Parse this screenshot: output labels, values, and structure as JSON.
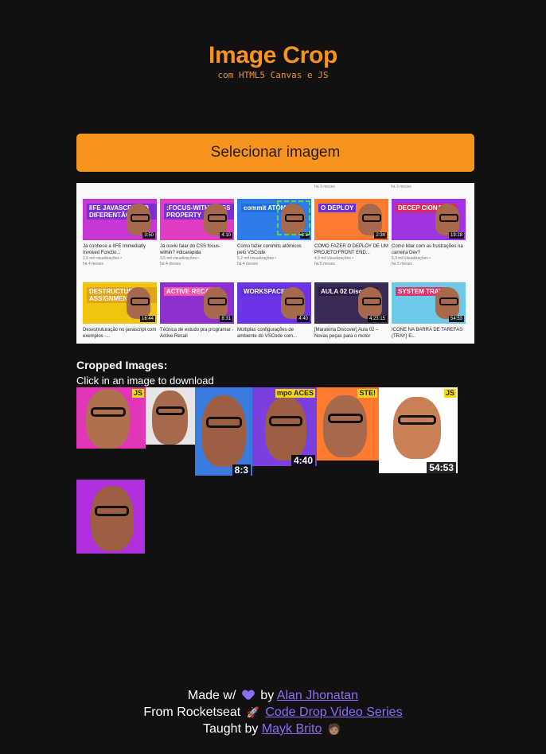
{
  "header": {
    "title": "Image Crop",
    "subtitle": "com HTML5 Canvas e JS"
  },
  "select_button": {
    "label": "Selecionar imagem"
  },
  "preview": {
    "top_meta": [
      "há 3 meses",
      "há 3 meses"
    ],
    "rows": [
      [
        {
          "tag": "IIFE JAVASCRIPT O DIFERENTÃO",
          "tag_color": "#7b2fd0",
          "bg": "#c936d6",
          "duration": "3:50",
          "title": "Já conhece a IIFE Immediatly Invoked Functio...",
          "views": "2,6 mil visualizações •",
          "age": "há 4 meses"
        },
        {
          "tag": ":FOCUS-WITHIN CSS PROPERTY",
          "tag_color": "#7b2fd0",
          "bg": "#e23cc4",
          "duration": "4:10",
          "title": "Já ouviu falar do CSS focus-within? #dicarapida",
          "views": "3,5 mil visualizações •",
          "age": "há 4 meses"
        },
        {
          "tag": "commit ATÔMICO",
          "tag_color": "#1f6fe0",
          "bg": "#2f7be9",
          "duration": "8:3",
          "title": "Como fazer commits atômicos pelo VSCode",
          "views": "5,2 mil visualizações •",
          "age": "há 4 meses"
        },
        {
          "tag": "O DEPLOY",
          "tag_color": "#6b2fd9",
          "bg": "#ff7a2e",
          "duration": "2:34",
          "title": "COMO FAZER O DEPLOY DE UM PROJETO FRONT END...",
          "views": "4,9 mil visualizações •",
          "age": "há 5 meses"
        },
        {
          "tag": "DECEP CIONADO!",
          "tag_color": "#e0265f",
          "bg": "#9f34e0",
          "duration": "19:28",
          "title": "Como lidar com as frustrações na carreira Dev?",
          "views": "6,3 mil visualizações •",
          "age": "há 5 meses"
        }
      ],
      [
        {
          "tag": "DESTRUCTURING ASSIGNMENT",
          "tag_color": "#e3a21a",
          "bg": "#f1c40f",
          "duration": "16:44",
          "title": "Desestruturação no javascript com exemplos -...",
          "views": "",
          "age": ""
        },
        {
          "tag": "ACTIVE RECALL",
          "tag_color": "#ff4fa6",
          "bg": "#8e2fd0",
          "duration": "8:31",
          "title": "Técnica de estudo pra programar - Active Recall",
          "views": "",
          "age": ""
        },
        {
          "tag": "WORKSPACES",
          "tag_color": "#5b2fd9",
          "bg": "#6b34e6",
          "duration": "4:40",
          "title": "Múltiplas configurações de ambiente do VSCode com...",
          "views": "",
          "age": ""
        },
        {
          "tag": "AULA 02 Discover",
          "tag_color": "#2b1a46",
          "bg": "#3a2a58",
          "duration": "4:23:15",
          "title": "[Maratona Discover] Aula 02 – Novas peças para o motor",
          "views": "",
          "age": ""
        },
        {
          "tag": "SYSTEM TRAY",
          "tag_color": "#e2336b",
          "bg": "#6cc9e8",
          "duration": "54:53",
          "title": "ÍCONE NA BARRA DE TAREFAS (TRAY) E...",
          "views": "",
          "age": ""
        }
      ]
    ]
  },
  "cropped": {
    "heading": "Cropped Images:",
    "hint": "Click in an image to download",
    "items": [
      {
        "bg": "#e236b8",
        "skin": "#b07050",
        "label": "",
        "badge": "JS"
      },
      {
        "bg": "#e6e6e6",
        "skin": "#a7694c",
        "label": "",
        "badge": ""
      },
      {
        "bg": "#3a7be0",
        "skin": "#9c5f43",
        "label": "8:3",
        "badge": ""
      },
      {
        "bg": "#7b3fe0",
        "skin": "#9c5f43",
        "label": "4:40",
        "badge": "mpo ACES"
      },
      {
        "bg": "#ff7a2e",
        "skin": "#a7694c",
        "label": "",
        "badge": "STE!"
      },
      {
        "bg": "#ffffff",
        "skin": "#c98055",
        "label": "54:53",
        "badge": "JS"
      },
      {
        "bg": "#b030e0",
        "skin": "#9c5f43",
        "label": "",
        "badge": ""
      }
    ]
  },
  "footer": {
    "line1_prefix": "Made w/",
    "line1_by": "by",
    "line1_link": "Alan Jhonatan",
    "line2_prefix": "From Rocketseat",
    "line2_link": "Code Drop Video Series",
    "line3_prefix": "Taught by",
    "line3_link": "Mayk Brito",
    "rocket_emoji": "🚀",
    "person_emoji": "🧑🏽"
  }
}
